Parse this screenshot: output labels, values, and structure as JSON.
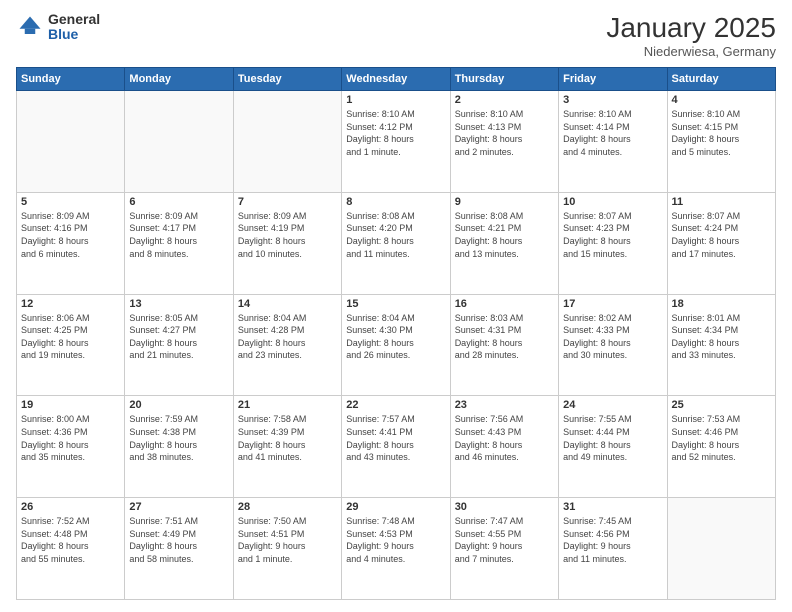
{
  "header": {
    "logo_general": "General",
    "logo_blue": "Blue",
    "month_title": "January 2025",
    "location": "Niederwiesa, Germany"
  },
  "weekdays": [
    "Sunday",
    "Monday",
    "Tuesday",
    "Wednesday",
    "Thursday",
    "Friday",
    "Saturday"
  ],
  "weeks": [
    [
      {
        "day": "",
        "info": ""
      },
      {
        "day": "",
        "info": ""
      },
      {
        "day": "",
        "info": ""
      },
      {
        "day": "1",
        "info": "Sunrise: 8:10 AM\nSunset: 4:12 PM\nDaylight: 8 hours\nand 1 minute."
      },
      {
        "day": "2",
        "info": "Sunrise: 8:10 AM\nSunset: 4:13 PM\nDaylight: 8 hours\nand 2 minutes."
      },
      {
        "day": "3",
        "info": "Sunrise: 8:10 AM\nSunset: 4:14 PM\nDaylight: 8 hours\nand 4 minutes."
      },
      {
        "day": "4",
        "info": "Sunrise: 8:10 AM\nSunset: 4:15 PM\nDaylight: 8 hours\nand 5 minutes."
      }
    ],
    [
      {
        "day": "5",
        "info": "Sunrise: 8:09 AM\nSunset: 4:16 PM\nDaylight: 8 hours\nand 6 minutes."
      },
      {
        "day": "6",
        "info": "Sunrise: 8:09 AM\nSunset: 4:17 PM\nDaylight: 8 hours\nand 8 minutes."
      },
      {
        "day": "7",
        "info": "Sunrise: 8:09 AM\nSunset: 4:19 PM\nDaylight: 8 hours\nand 10 minutes."
      },
      {
        "day": "8",
        "info": "Sunrise: 8:08 AM\nSunset: 4:20 PM\nDaylight: 8 hours\nand 11 minutes."
      },
      {
        "day": "9",
        "info": "Sunrise: 8:08 AM\nSunset: 4:21 PM\nDaylight: 8 hours\nand 13 minutes."
      },
      {
        "day": "10",
        "info": "Sunrise: 8:07 AM\nSunset: 4:23 PM\nDaylight: 8 hours\nand 15 minutes."
      },
      {
        "day": "11",
        "info": "Sunrise: 8:07 AM\nSunset: 4:24 PM\nDaylight: 8 hours\nand 17 minutes."
      }
    ],
    [
      {
        "day": "12",
        "info": "Sunrise: 8:06 AM\nSunset: 4:25 PM\nDaylight: 8 hours\nand 19 minutes."
      },
      {
        "day": "13",
        "info": "Sunrise: 8:05 AM\nSunset: 4:27 PM\nDaylight: 8 hours\nand 21 minutes."
      },
      {
        "day": "14",
        "info": "Sunrise: 8:04 AM\nSunset: 4:28 PM\nDaylight: 8 hours\nand 23 minutes."
      },
      {
        "day": "15",
        "info": "Sunrise: 8:04 AM\nSunset: 4:30 PM\nDaylight: 8 hours\nand 26 minutes."
      },
      {
        "day": "16",
        "info": "Sunrise: 8:03 AM\nSunset: 4:31 PM\nDaylight: 8 hours\nand 28 minutes."
      },
      {
        "day": "17",
        "info": "Sunrise: 8:02 AM\nSunset: 4:33 PM\nDaylight: 8 hours\nand 30 minutes."
      },
      {
        "day": "18",
        "info": "Sunrise: 8:01 AM\nSunset: 4:34 PM\nDaylight: 8 hours\nand 33 minutes."
      }
    ],
    [
      {
        "day": "19",
        "info": "Sunrise: 8:00 AM\nSunset: 4:36 PM\nDaylight: 8 hours\nand 35 minutes."
      },
      {
        "day": "20",
        "info": "Sunrise: 7:59 AM\nSunset: 4:38 PM\nDaylight: 8 hours\nand 38 minutes."
      },
      {
        "day": "21",
        "info": "Sunrise: 7:58 AM\nSunset: 4:39 PM\nDaylight: 8 hours\nand 41 minutes."
      },
      {
        "day": "22",
        "info": "Sunrise: 7:57 AM\nSunset: 4:41 PM\nDaylight: 8 hours\nand 43 minutes."
      },
      {
        "day": "23",
        "info": "Sunrise: 7:56 AM\nSunset: 4:43 PM\nDaylight: 8 hours\nand 46 minutes."
      },
      {
        "day": "24",
        "info": "Sunrise: 7:55 AM\nSunset: 4:44 PM\nDaylight: 8 hours\nand 49 minutes."
      },
      {
        "day": "25",
        "info": "Sunrise: 7:53 AM\nSunset: 4:46 PM\nDaylight: 8 hours\nand 52 minutes."
      }
    ],
    [
      {
        "day": "26",
        "info": "Sunrise: 7:52 AM\nSunset: 4:48 PM\nDaylight: 8 hours\nand 55 minutes."
      },
      {
        "day": "27",
        "info": "Sunrise: 7:51 AM\nSunset: 4:49 PM\nDaylight: 8 hours\nand 58 minutes."
      },
      {
        "day": "28",
        "info": "Sunrise: 7:50 AM\nSunset: 4:51 PM\nDaylight: 9 hours\nand 1 minute."
      },
      {
        "day": "29",
        "info": "Sunrise: 7:48 AM\nSunset: 4:53 PM\nDaylight: 9 hours\nand 4 minutes."
      },
      {
        "day": "30",
        "info": "Sunrise: 7:47 AM\nSunset: 4:55 PM\nDaylight: 9 hours\nand 7 minutes."
      },
      {
        "day": "31",
        "info": "Sunrise: 7:45 AM\nSunset: 4:56 PM\nDaylight: 9 hours\nand 11 minutes."
      },
      {
        "day": "",
        "info": ""
      }
    ]
  ]
}
